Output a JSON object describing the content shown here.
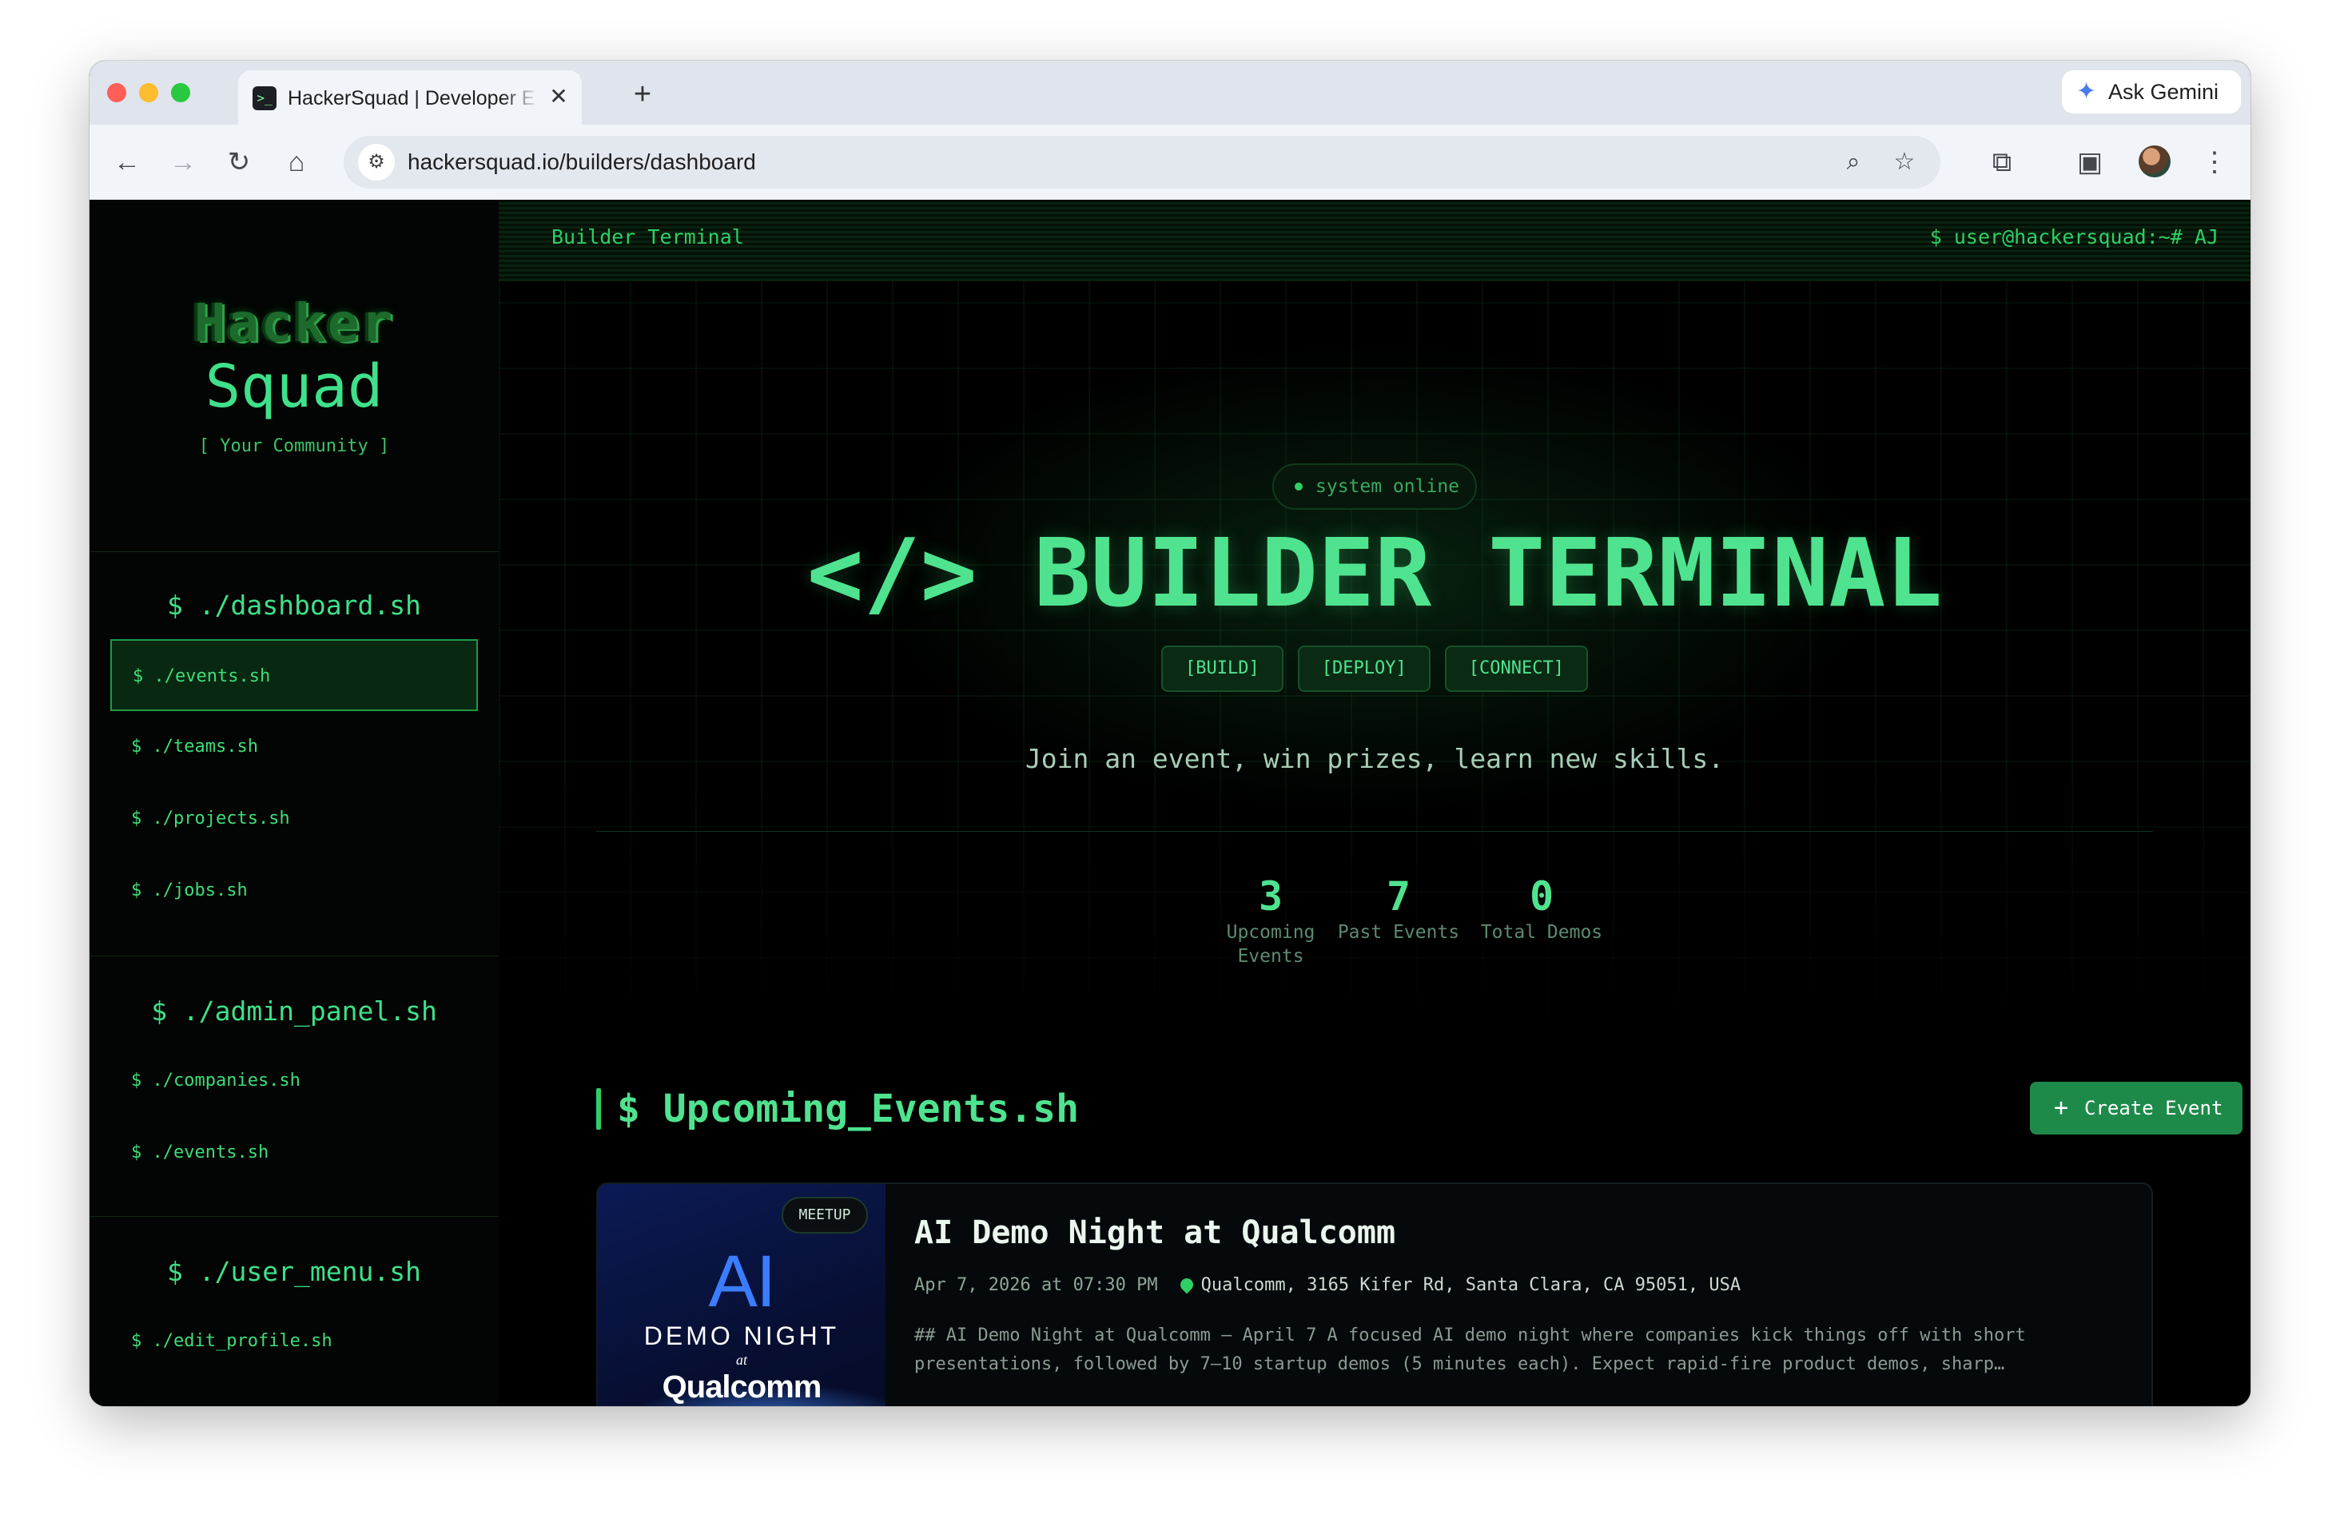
{
  "browser": {
    "tab_title": "HackerSquad | Developer Eco",
    "tab_close": "✕",
    "new_tab": "+",
    "gemini_label": "Ask Gemini",
    "url": "hackersquad.io/builders/dashboard"
  },
  "sidebar": {
    "logo_top": "Hacker",
    "logo_bottom": "Squad",
    "tagline": "[ Your Community ]",
    "sections": [
      {
        "title": "$ ./dashboard.sh",
        "items": [
          {
            "label": "$ ./events.sh",
            "active": true
          },
          {
            "label": "$ ./teams.sh"
          },
          {
            "label": "$ ./projects.sh"
          },
          {
            "label": "$ ./jobs.sh"
          }
        ]
      },
      {
        "title": "$ ./admin_panel.sh",
        "items": [
          {
            "label": "$ ./companies.sh"
          },
          {
            "label": "$ ./events.sh"
          }
        ]
      },
      {
        "title": "$ ./user_menu.sh",
        "items": [
          {
            "label": "$ ./edit_profile.sh"
          }
        ]
      }
    ]
  },
  "topbar": {
    "left": "Builder Terminal",
    "right": "$ user@hackersquad:~# AJ"
  },
  "hero": {
    "status": "system online",
    "title": "</> BUILDER TERMINAL",
    "tags": [
      "[BUILD]",
      "[DEPLOY]",
      "[CONNECT]"
    ],
    "subtitle": "Join an event, win prizes, learn new skills.",
    "stats": [
      {
        "value": "3",
        "label": "Upcoming Events"
      },
      {
        "value": "7",
        "label": "Past Events"
      },
      {
        "value": "0",
        "label": "Total Demos"
      }
    ]
  },
  "events_section": {
    "title": "$ Upcoming_Events.sh",
    "create_label": "Create Event",
    "events": [
      {
        "badge": "MEETUP",
        "image_text": {
          "ai": "AI",
          "demo": "DEMO NIGHT",
          "at": "at",
          "brand": "Qualcomm"
        },
        "title": "AI Demo Night at Qualcomm",
        "date": "Apr 7, 2026 at 07:30 PM",
        "location": "Qualcomm, 3165 Kifer Rd, Santa Clara, CA 95051, USA",
        "description_lines": [
          "## AI Demo Night at Qualcomm – April 7 A focused AI demo night where companies kick things off with short",
          "presentations, followed by 7–10 startup demos (5 minutes each). Expect rapid-fire product demos, sharp…"
        ]
      }
    ]
  },
  "colors": {
    "accent": "#4fe38f",
    "terminal_green": "#2fcf63",
    "button_green": "#1e8a4a",
    "background": "#000000"
  },
  "icons": [
    "back-icon",
    "forward-icon",
    "reload-icon",
    "home-icon",
    "site-settings-icon",
    "zoom-icon",
    "bookmark-star-icon",
    "extensions-icon",
    "tab-search-icon",
    "profile-avatar",
    "more-menu-icon",
    "gemini-icon",
    "location-pin-icon",
    "plus-icon"
  ]
}
